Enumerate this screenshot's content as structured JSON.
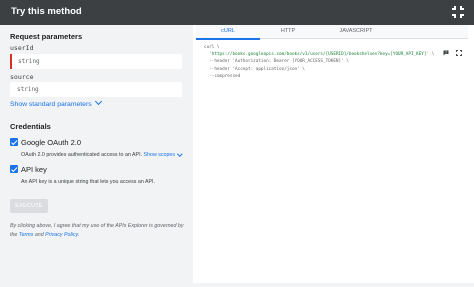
{
  "header": {
    "title": "Try this method"
  },
  "request": {
    "title": "Request parameters",
    "fields": [
      {
        "label": "userId",
        "placeholder": "string",
        "required": true
      },
      {
        "label": "source",
        "placeholder": "string",
        "required": false
      }
    ],
    "show_standard": "Show standard parameters"
  },
  "credentials": {
    "title": "Credentials",
    "items": [
      {
        "label": "Google OAuth 2.0",
        "checked": true,
        "desc": "OAuth 2.0 provides authenticated access to an API.",
        "link": "Show scopes"
      },
      {
        "label": "API key",
        "checked": true,
        "desc": "An API key is a unique string that lets you access an API."
      }
    ]
  },
  "execute_label": "EXECUTE",
  "terms": {
    "pre": "By clicking above, I agree that my use of the APIs Explorer is governed by the ",
    "terms_link": "Terms",
    "mid": " and ",
    "privacy_link": "Privacy Policy",
    "post": "."
  },
  "tabs": [
    "cURL",
    "HTTP",
    "JAVASCRIPT"
  ],
  "active_tab": "cURL",
  "code": {
    "l1": "curl \\",
    "l2_q1": "  '",
    "l2_url": "https://books.googleapis.com/books/v1/users/[USERID]/bookshelves?key=[YOUR_API_KEY]",
    "l2_q2": "' \\",
    "l3": "  --header 'Authorization: Bearer [YOUR_ACCESS_TOKEN]' \\",
    "l4": "  --header 'Accept: application/json' \\",
    "l5": "  --compressed"
  },
  "colors": {
    "header_bg": "#3c4043",
    "accent": "#1a73e8",
    "required": "#d93025",
    "panel_bg": "#f1f3f4"
  }
}
